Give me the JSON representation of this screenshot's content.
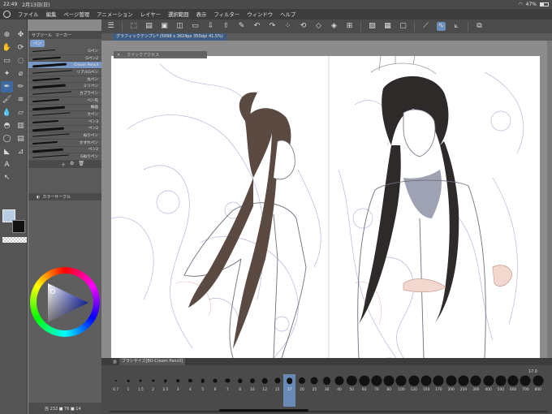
{
  "status": {
    "time": "22:49",
    "date": "2月13日(日)",
    "battery": "47%",
    "battery_level": 0.47
  },
  "menu": [
    "ファイル",
    "編集",
    "ページ管理",
    "アニメーション",
    "レイヤー",
    "選択範囲",
    "表示",
    "フィルター",
    "ウィンドウ",
    "ヘルプ"
  ],
  "subtool": {
    "tabs_top": [
      "サブツール",
      "マーカー"
    ],
    "tab_pen": "ペン",
    "brushes": [
      {
        "label": "Gペン",
        "selected": false
      },
      {
        "label": "Gペン2",
        "selected": false
      },
      {
        "label": "Cream Pencil",
        "selected": true
      },
      {
        "label": "リアルGペン",
        "selected": false
      },
      {
        "label": "丸ペン",
        "selected": false
      },
      {
        "label": "ミリペン",
        "selected": false
      },
      {
        "label": "カブラペン",
        "selected": false
      },
      {
        "label": "ペン先",
        "selected": false
      },
      {
        "label": "線画",
        "selected": false
      },
      {
        "label": "カペン",
        "selected": false
      },
      {
        "label": "ペン3",
        "selected": false
      },
      {
        "label": "ペン2",
        "selected": false
      },
      {
        "label": "ぬりペン",
        "selected": false
      },
      {
        "label": "かすれペン",
        "selected": false
      },
      {
        "label": "ペン2",
        "selected": false
      },
      {
        "label": "Gぬりペン",
        "selected": false
      }
    ]
  },
  "colorpanel": {
    "title": "カラーサークル",
    "foot": "自 232 ■ 76 ■ 14"
  },
  "canvas": {
    "tab_title": "グラフィックテンプレ* (5098 x 3624px 350dpi 41.5%)",
    "quick_access": "クイックアクセス"
  },
  "brushsize": {
    "title": "ブラシサイズ[BU-Cream Pencil]",
    "current": "17.0",
    "sizes": [
      "0.7",
      "1",
      "1.5",
      "2",
      "2.5",
      "3",
      "4",
      "5",
      "6",
      "7",
      "8",
      "10",
      "12",
      "15",
      "17",
      "20",
      "25",
      "30",
      "40",
      "50",
      "60",
      "70",
      "80",
      "100",
      "120",
      "150",
      "170",
      "200",
      "250",
      "300",
      "400",
      "500",
      "600",
      "700",
      "800",
      "1000",
      "1200",
      "1500",
      "1700",
      "2000"
    ],
    "selected_index": 14
  },
  "colors": {
    "main": "#b8cce4",
    "sub": "#111111",
    "accent": "#3f6aa1"
  }
}
